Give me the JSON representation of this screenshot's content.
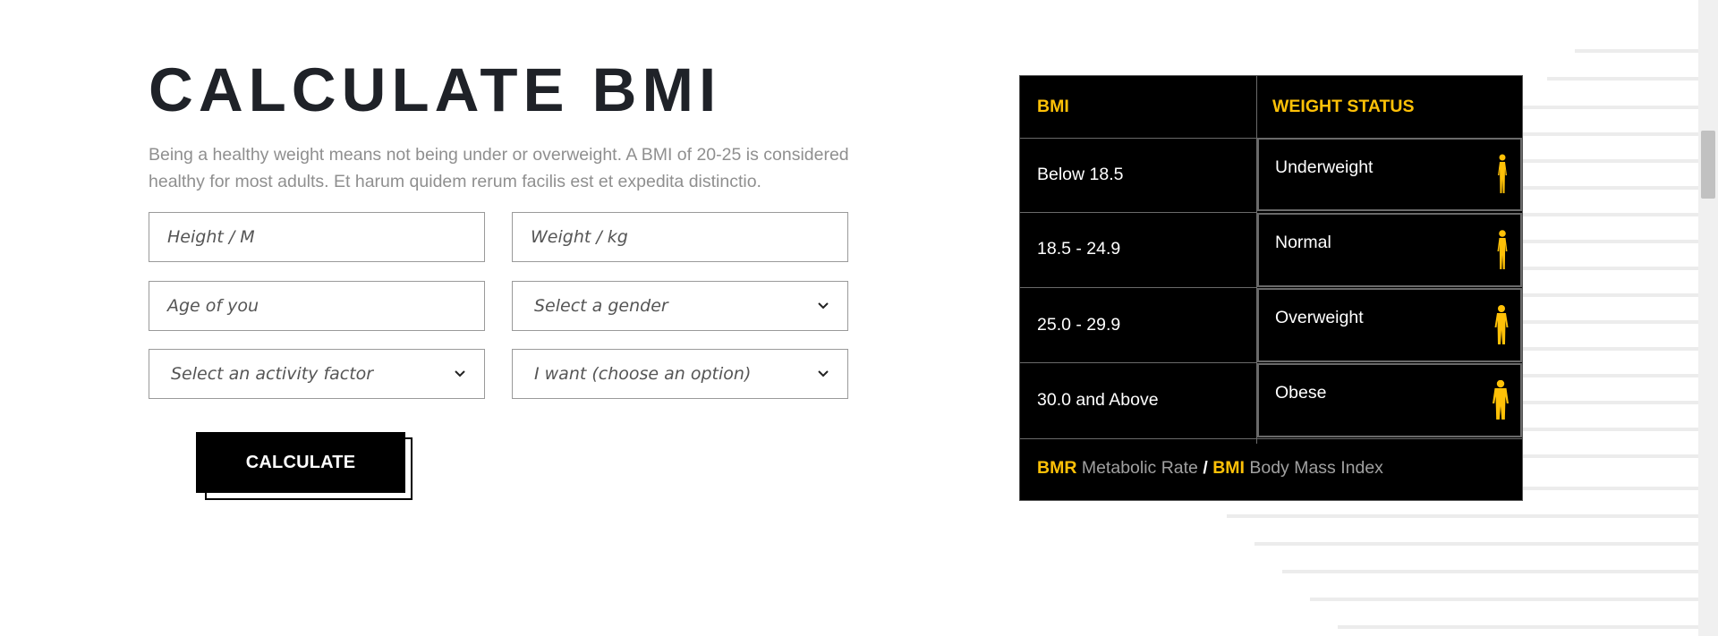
{
  "section": {
    "title": "CALCULATE BMI",
    "description": "Being a healthy weight means not being under or overweight. A BMI of 20-25 is considered healthy for most adults. Et harum quidem rerum facilis est et expedita distinctio."
  },
  "form": {
    "height_placeholder": "Height / M",
    "weight_placeholder": "Weight / kg",
    "age_placeholder": "Age of you",
    "gender_selected": "Select a gender",
    "activity_selected": "Select an activity factor",
    "goal_selected": "I want (choose an option)",
    "calculate_label": "CALCULATE"
  },
  "bmi_table": {
    "headers": {
      "bmi": "BMI",
      "status": "WEIGHT STATUS"
    },
    "rows": [
      {
        "range": "Below 18.5",
        "status": "Underweight",
        "icon": "person-icon"
      },
      {
        "range": "18.5 - 24.9",
        "status": "Normal",
        "icon": "person-icon"
      },
      {
        "range": "25.0 - 29.9",
        "status": "Overweight",
        "icon": "person-icon"
      },
      {
        "range": "30.0 and Above",
        "status": "Obese",
        "icon": "person-icon"
      }
    ],
    "footer": {
      "bmr_abbr": "BMR",
      "bmr_text": "Metabolic Rate",
      "separator": "/",
      "bmi_abbr": "BMI",
      "bmi_text": "Body Mass Index"
    }
  },
  "colors": {
    "accent": "#ffc107",
    "title": "#1f2228",
    "table_bg": "#000000",
    "muted_text": "#8f8f8f"
  }
}
